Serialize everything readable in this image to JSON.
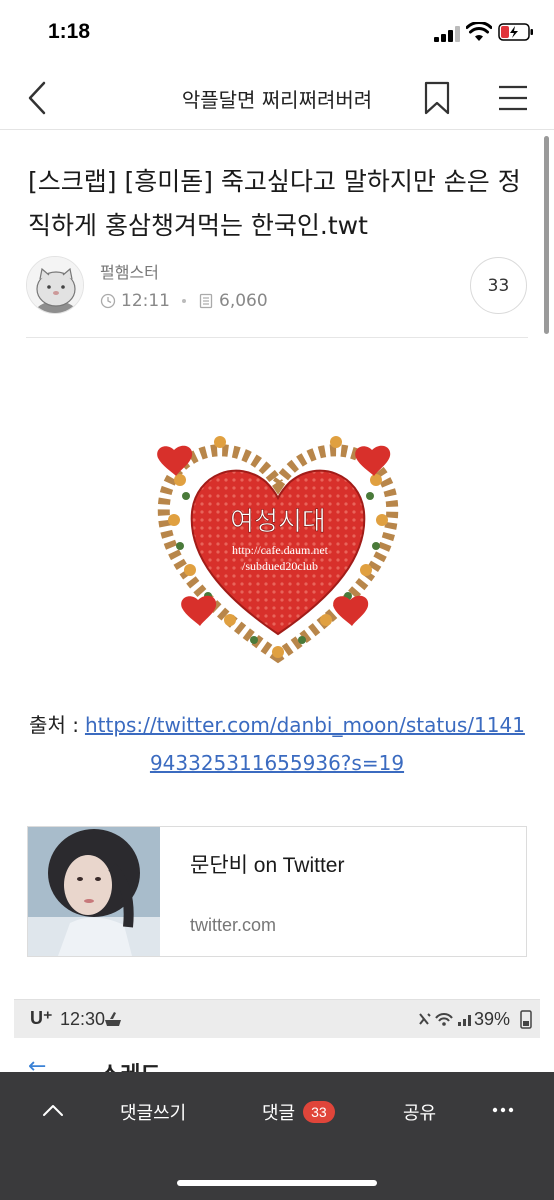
{
  "status_bar": {
    "time": "1:18"
  },
  "header": {
    "title": "악플달면 쩌리쩌려버려"
  },
  "post": {
    "title": "[스크랩] [흥미돋] 죽고싶다고 말하지만 손은 정직하게 홍삼챙겨먹는 한국인.twt",
    "author": "펄햄스터",
    "time": "12:11",
    "views": "6,060",
    "comment_count": "33"
  },
  "image": {
    "heart_text": "여성시대",
    "url_line1": "http://cafe.daum.net",
    "url_line2": "/subdued20club"
  },
  "source": {
    "label": "출처 :",
    "url_line1": "https://twitter.com/danbi_moon/status/1141",
    "url_line2": "943325311655936?s=19"
  },
  "link_card": {
    "title": "문단비 on Twitter",
    "domain": "twitter.com"
  },
  "embedded_screenshot": {
    "carrier": "U⁺",
    "time": "12:30",
    "battery": "39%",
    "title": "스레드"
  },
  "bottom_bar": {
    "write_label": "댓글쓰기",
    "comments_label": "댓글",
    "comments_count": "33",
    "share_label": "공유"
  },
  "colors": {
    "link": "#3b6bc0",
    "badge": "#e0453a",
    "bottom_bar_bg": "#3a3a3c",
    "heart_red": "#d8302b"
  }
}
